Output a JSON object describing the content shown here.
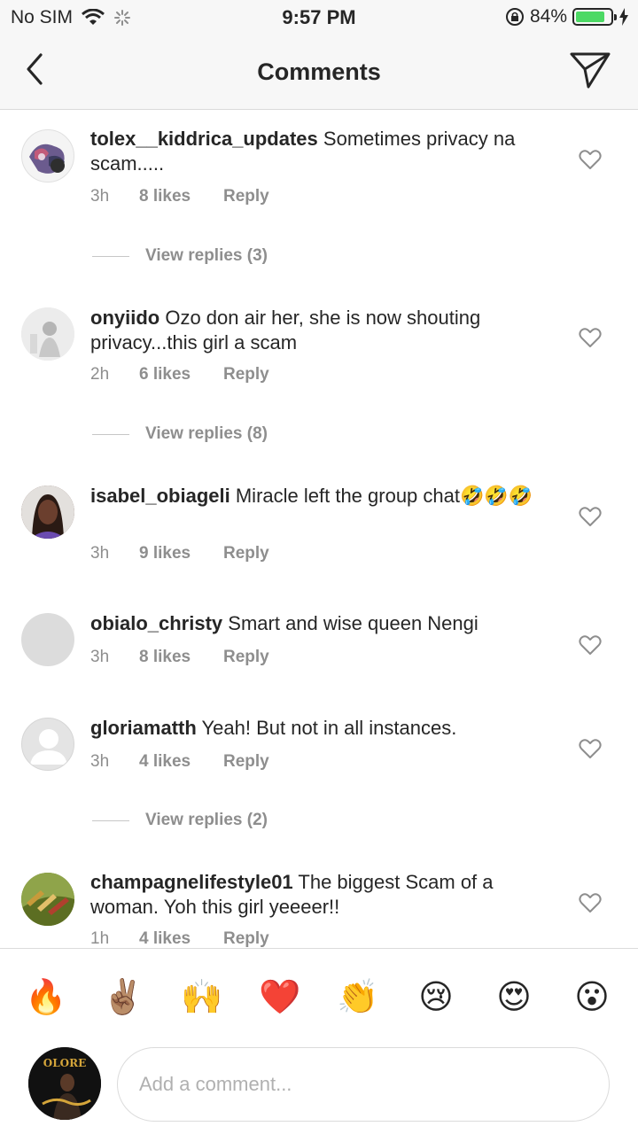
{
  "status_bar": {
    "carrier": "No SIM",
    "time": "9:57 PM",
    "battery_percent": "84%",
    "battery_level": 0.84,
    "icons": [
      "wifi-icon",
      "loading-spinner-icon",
      "orientation-lock-icon",
      "battery-icon",
      "charging-bolt-icon"
    ]
  },
  "header": {
    "title": "Comments",
    "back_icon": "chevron-left-icon",
    "send_icon": "paper-plane-icon"
  },
  "comments": [
    {
      "username": "tolex__kiddrica_updates",
      "text": "Sometimes privacy na scam.....",
      "time": "3h",
      "likes": "8 likes",
      "reply": "Reply",
      "view_replies": "View replies (3)"
    },
    {
      "username": "onyiido",
      "text": "Ozo don air her, she is now shouting privacy...this girl a scam",
      "time": "2h",
      "likes": "6 likes",
      "reply": "Reply",
      "view_replies": "View replies (8)"
    },
    {
      "username": "isabel_obiageli",
      "text": "Miracle left the group chat🤣🤣🤣",
      "time": "3h",
      "likes": "9 likes",
      "reply": "Reply"
    },
    {
      "username": "obialo_christy",
      "text": "Smart and wise queen Nengi",
      "time": "3h",
      "likes": "8 likes",
      "reply": "Reply"
    },
    {
      "username": "gloriamatth",
      "text": "Yeah! But not in all instances.",
      "time": "3h",
      "likes": "4 likes",
      "reply": "Reply",
      "view_replies": "View replies (2)"
    },
    {
      "username": "champagnelifestyle01",
      "text": "The biggest Scam of a woman. Yoh this girl yeeeer!!",
      "time": "1h",
      "likes": "4 likes",
      "reply": "Reply"
    }
  ],
  "emoji_bar": {
    "emojis": [
      "🔥",
      "✌🏽",
      "🙌",
      "❤️",
      "👏",
      "😢",
      "😍",
      "😮"
    ]
  },
  "composer": {
    "placeholder": "Add a comment...",
    "avatar_text": "OLORE"
  },
  "colors": {
    "text": "#262626",
    "secondary": "#8e8e8e",
    "battery_green": "#4cd964",
    "divider": "#dbdbdb"
  }
}
